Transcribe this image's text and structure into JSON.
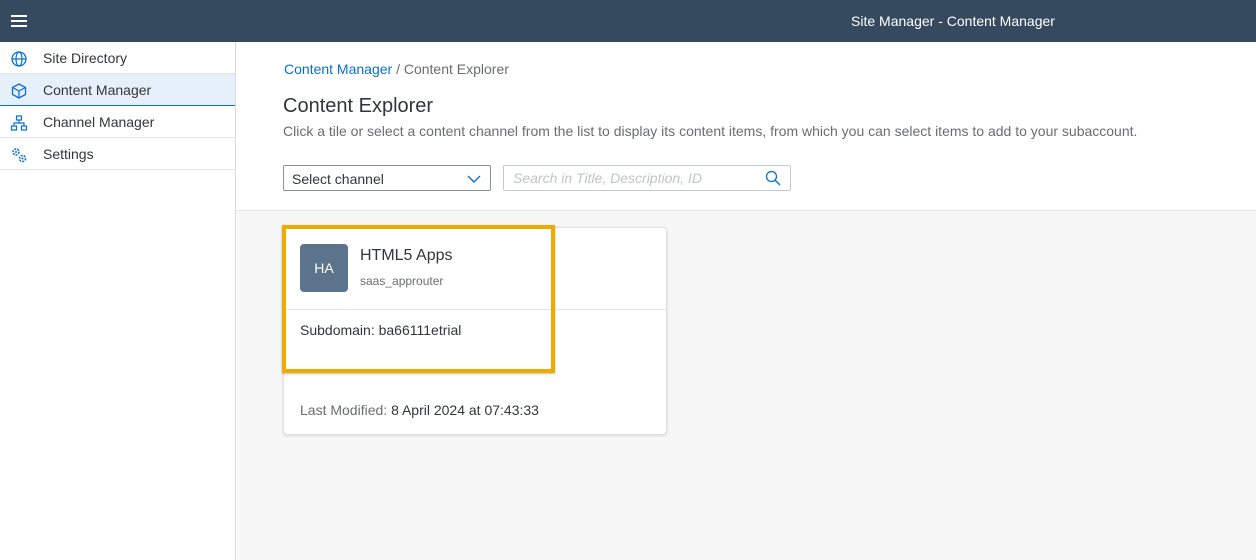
{
  "shell": {
    "title": "Site Manager - Content Manager"
  },
  "sidebar": {
    "items": [
      {
        "label": "Site Directory",
        "icon": "globe-icon"
      },
      {
        "label": "Content Manager",
        "icon": "cube-icon"
      },
      {
        "label": "Channel Manager",
        "icon": "hierarchy-icon"
      },
      {
        "label": "Settings",
        "icon": "gears-icon"
      }
    ]
  },
  "breadcrumb": {
    "link": "Content Manager",
    "separator": "/",
    "current": "Content Explorer"
  },
  "page": {
    "title": "Content Explorer",
    "description": "Click a tile or select a content channel from the list to display its content items, from which you can select items to add to your subaccount."
  },
  "filters": {
    "channel_select": "Select channel",
    "search_placeholder": "Search in Title, Description, ID"
  },
  "tile": {
    "avatar_initials": "HA",
    "title": "HTML5 Apps",
    "subtitle": "saas_approuter",
    "subdomain": "Subdomain: ba66111etrial",
    "last_modified_label": "Last Modified:",
    "last_modified_value": "8 April 2024 at 07:43:33"
  },
  "colors": {
    "shell": "#354a5f",
    "accent": "#0a6ed1",
    "highlight": "#f0ab00",
    "avatar": "#5b738b"
  }
}
